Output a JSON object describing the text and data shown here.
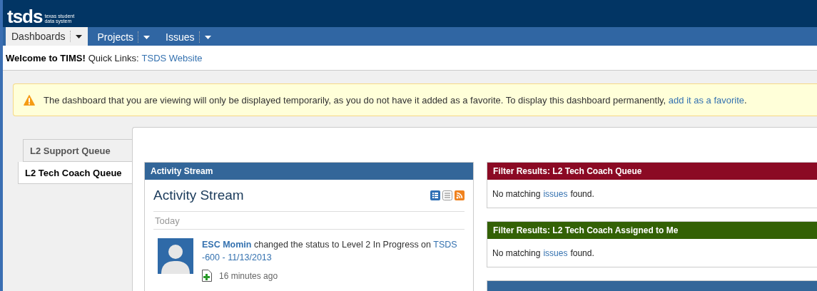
{
  "logo": {
    "mark": "tsds",
    "tagline": "texas student data system"
  },
  "nav": [
    {
      "label": "Dashboards",
      "selected": true
    },
    {
      "label": "Projects",
      "selected": false
    },
    {
      "label": "Issues",
      "selected": false
    }
  ],
  "welcome": {
    "greeting": "Welcome to TIMS!",
    "quick_links_label": "Quick Links:",
    "link": "TSDS Website"
  },
  "warning": {
    "text": "The dashboard that you are viewing will only be displayed temporarily, as you do not have it added as a favorite. To display this dashboard permanently,",
    "link": "add it as a favorite",
    "end": "."
  },
  "dashboard_tabs": [
    {
      "label": "L2 Support Queue",
      "selected": false
    },
    {
      "label": "L2 Tech Coach Queue",
      "selected": true
    }
  ],
  "activity": {
    "header": "Activity Stream",
    "title": "Activity Stream",
    "day": "Today",
    "items": [
      {
        "user": "ESC Momin",
        "action": "changed the status to Level 2 In Progress on",
        "issue": "TSDS -600 - 11/13/2013",
        "time": "16 minutes ago"
      }
    ]
  },
  "filters": [
    {
      "title": "Filter Results: L2 Tech Coach Queue",
      "color": "#8b0a24",
      "before": "No matching",
      "link": "issues",
      "after": "found."
    },
    {
      "title": "Filter Results: L2 Tech Coach Assigned to Me",
      "color": "#336105",
      "before": "No matching",
      "link": "issues",
      "after": "found."
    },
    {
      "color": "#336699"
    }
  ]
}
